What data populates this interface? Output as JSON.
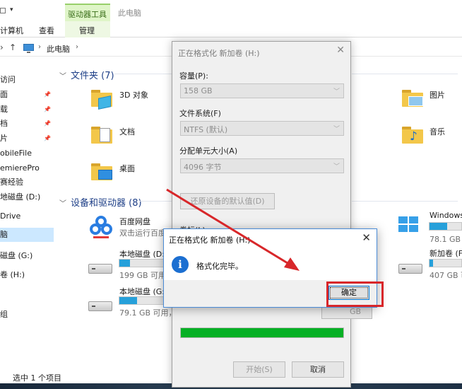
{
  "explorer": {
    "title": "此电脑",
    "ribbon_context_tab": "驱动器工具",
    "tabs": [
      "计算机",
      "查看",
      "管理"
    ],
    "breadcrumb": "此电脑",
    "nav_items": [
      {
        "label": "访问",
        "pinned": false
      },
      {
        "label": "面",
        "pinned": true
      },
      {
        "label": "载",
        "pinned": true
      },
      {
        "label": "档",
        "pinned": true
      },
      {
        "label": "片",
        "pinned": true
      },
      {
        "label": "obileFile",
        "pinned": false
      },
      {
        "label": "emierePro",
        "pinned": false
      },
      {
        "label": "赛经验",
        "pinned": false
      },
      {
        "label": "地磁盘 (D:)",
        "pinned": false
      },
      {
        "label": "Drive",
        "pinned": false
      },
      {
        "label": "脑",
        "pinned": false,
        "selected": true
      },
      {
        "label": "磁盘 (G:)",
        "pinned": false
      },
      {
        "label": "卷 (H:)",
        "pinned": false
      },
      {
        "label": "组",
        "pinned": false
      }
    ],
    "folders_header": "文件夹 (7)",
    "folders": [
      {
        "name": "3D 对象",
        "overlay": "3d"
      },
      {
        "name": "文档",
        "overlay": "doc"
      },
      {
        "name": "桌面",
        "overlay": "desktop"
      },
      {
        "name": "图片",
        "overlay": "picture"
      },
      {
        "name": "音乐",
        "overlay": "music"
      }
    ],
    "devices_header": "设备和驱动器 (8)",
    "devices": [
      {
        "name": "百度网盘",
        "subtitle": "双击运行百度网盘",
        "icon": "baidu-netdisk-icon"
      },
      {
        "name": "本地磁盘 (D:)",
        "free": "199 GB 可用，",
        "used_fraction": 0.22
      },
      {
        "name": "本地磁盘 (G:)",
        "free": "79.1 GB 可用，",
        "used_fraction": 0.35
      },
      {
        "name": "Windows",
        "free": "78.1 GB 可",
        "used_fraction": 0.55,
        "icon": "windows-icon"
      },
      {
        "name": "新加卷 (F:",
        "free": "407 GB 可",
        "used_fraction": 0.1
      }
    ],
    "status": "选中 1 个项目"
  },
  "format_dialog": {
    "title": "正在格式化 新加卷 (H:)",
    "capacity_label": "容量(P):",
    "capacity_value": "158 GB",
    "fs_label": "文件系统(F)",
    "fs_value": "NTFS (默认)",
    "alloc_label": "分配单元大小(A)",
    "alloc_value": "4096 字节",
    "restore_button": "还原设备的默认值(D)",
    "volume_label_partial": "卷标(L)",
    "partial_button": "GB",
    "progress": 1.0,
    "start_button": "开始(S)",
    "cancel_button": "取消"
  },
  "message_box": {
    "title": "正在格式化 新加卷 (H:)",
    "message": "格式化完毕。",
    "ok_button": "确定"
  },
  "colors": {
    "progress_green": "#06b025",
    "drive_bar_blue": "#26a0da",
    "annotation_red": "#d8272a",
    "context_tab_green": "#dff5c8"
  }
}
